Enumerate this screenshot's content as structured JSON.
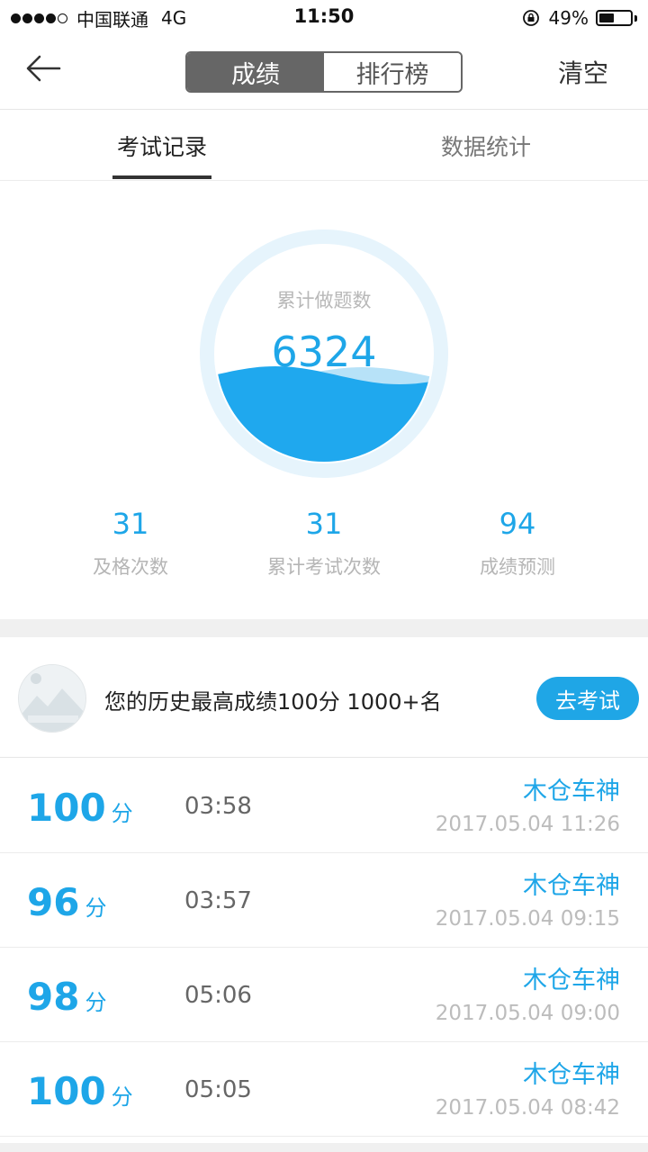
{
  "status_bar": {
    "carrier": "中国联通",
    "network": "4G",
    "time": "11:50",
    "battery_text": "49%",
    "battery_level": 0.49
  },
  "nav": {
    "segments": [
      "成绩",
      "排行榜"
    ],
    "active_segment": 0,
    "clear_label": "清空",
    "back_icon": "arrow-left-icon"
  },
  "tabs": [
    {
      "label": "考试记录",
      "active": true
    },
    {
      "label": "数据统计",
      "active": false
    }
  ],
  "gauge": {
    "label": "累计做题数",
    "value": "6324",
    "fill_level": 0.4,
    "colors": {
      "ring": "#e6f4fc",
      "wave": "#1fa8ee",
      "wave_light": "#b7e2f8"
    }
  },
  "stats": [
    {
      "value": "31",
      "label": "及格次数"
    },
    {
      "value": "31",
      "label": "累计考试次数"
    },
    {
      "value": "94",
      "label": "成绩预测"
    }
  ],
  "best": {
    "text": "您的历史最高成绩100分  1000+名",
    "button_label": "去考试",
    "avatar_icon": "mountain-image-icon"
  },
  "records": [
    {
      "score": "100",
      "unit": "分",
      "time": "03:58",
      "name": "木仓车神",
      "date": "2017.05.04 11:26"
    },
    {
      "score": "96",
      "unit": "分",
      "time": "03:57",
      "name": "木仓车神",
      "date": "2017.05.04 09:15"
    },
    {
      "score": "98",
      "unit": "分",
      "time": "05:06",
      "name": "木仓车神",
      "date": "2017.05.04 09:00"
    },
    {
      "score": "100",
      "unit": "分",
      "time": "05:05",
      "name": "木仓车神",
      "date": "2017.05.04 08:42"
    }
  ],
  "colors": {
    "accent": "#1ea6e8",
    "segment_active": "#666666"
  }
}
